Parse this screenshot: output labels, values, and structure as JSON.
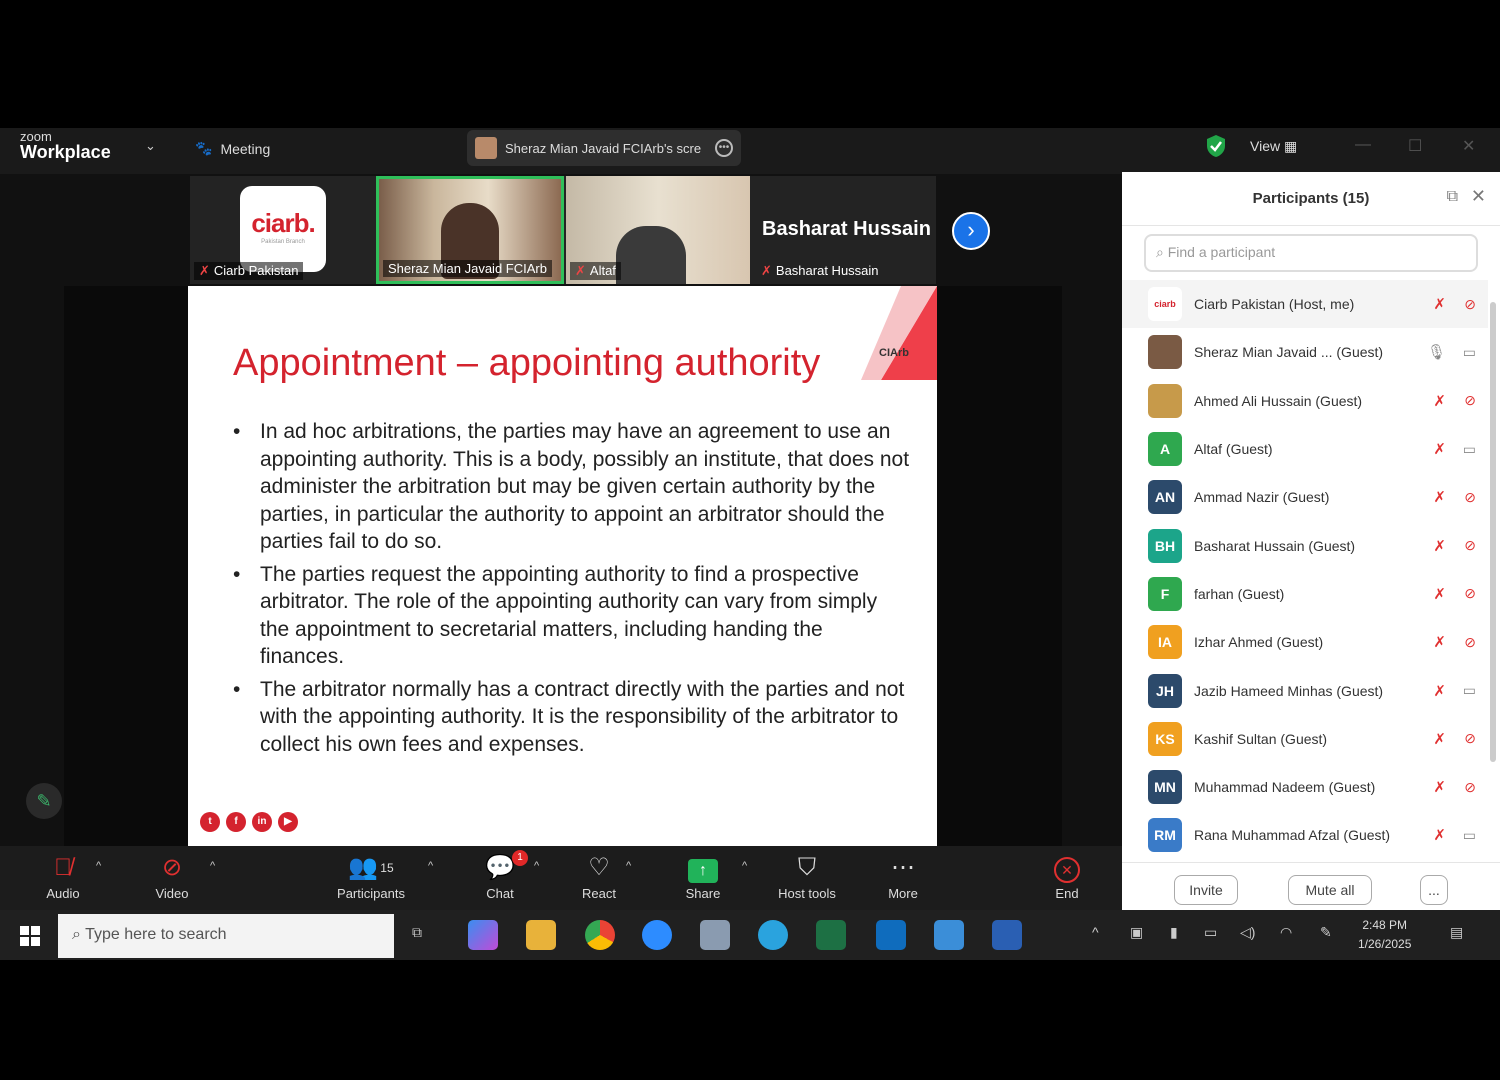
{
  "window": {
    "logo_top": "zoom",
    "logo_bottom": "Workplace",
    "meeting_label": "Meeting",
    "share_label": "Sheraz Mian Javaid FCIArb's scre",
    "view_label": "View"
  },
  "gallery": {
    "tiles": [
      {
        "name": "Ciarb Pakistan",
        "logo_text": "ciarb.",
        "logo_sub": "Pakistan Branch"
      },
      {
        "name": "Sheraz Mian Javaid FCIArb"
      },
      {
        "name": "Altaf"
      },
      {
        "name": "Basharat Hussain",
        "big_name": "Basharat Hussain"
      }
    ]
  },
  "slide": {
    "title": "Appointment – appointing authority",
    "logo_text": "CIArb",
    "bullets": [
      "In ad hoc arbitrations, the parties may have an agreement to use an appointing authority. This is a body, possibly an institute, that does not administer the arbitration but may be given certain authority by the parties, in particular the authority to appoint an arbitrator should the parties fail to do so.",
      "The parties request the appointing authority to find a prospective arbitrator. The role of the appointing authority can vary from simply the appointment to secretarial matters, including handing the finances.",
      "The arbitrator normally has a contract directly with the parties and not with the appointing authority. It is the responsibility of the arbitrator to collect his own fees and expenses."
    ]
  },
  "toolbar": {
    "audio": "Audio",
    "video": "Video",
    "participants": "Participants",
    "participants_count": "15",
    "chat": "Chat",
    "chat_badge": "1",
    "react": "React",
    "share": "Share",
    "host_tools": "Host tools",
    "more": "More",
    "end": "End"
  },
  "panel": {
    "title": "Participants (15)",
    "search_placeholder": "Find a participant",
    "participants": [
      {
        "name": "Ciarb Pakistan (Host, me)",
        "initials": "",
        "color": "#ffffff",
        "mic": "muted",
        "cam": "off"
      },
      {
        "name": "Sheraz Mian Javaid ... (Guest)",
        "initials": "",
        "color": "#7a5a44",
        "mic": "on",
        "cam": "on"
      },
      {
        "name": "Ahmed Ali Hussain (Guest)",
        "initials": "",
        "color": "#c79a4a",
        "mic": "muted",
        "cam": "off"
      },
      {
        "name": "Altaf (Guest)",
        "initials": "A",
        "color": "#2fa84f",
        "mic": "muted",
        "cam": "on"
      },
      {
        "name": "Ammad Nazir (Guest)",
        "initials": "AN",
        "color": "#2c4a6b",
        "mic": "muted",
        "cam": "off"
      },
      {
        "name": "Basharat Hussain (Guest)",
        "initials": "BH",
        "color": "#1ca58a",
        "mic": "muted",
        "cam": "off"
      },
      {
        "name": "farhan (Guest)",
        "initials": "F",
        "color": "#2fa84f",
        "mic": "muted",
        "cam": "off"
      },
      {
        "name": "Izhar Ahmed (Guest)",
        "initials": "IA",
        "color": "#f0a020",
        "mic": "muted",
        "cam": "off"
      },
      {
        "name": "Jazib Hameed Minhas (Guest)",
        "initials": "JH",
        "color": "#2c4a6b",
        "mic": "muted",
        "cam": "on"
      },
      {
        "name": "Kashif Sultan (Guest)",
        "initials": "KS",
        "color": "#f0a020",
        "mic": "muted",
        "cam": "off"
      },
      {
        "name": "Muhammad Nadeem (Guest)",
        "initials": "MN",
        "color": "#2c4a6b",
        "mic": "muted",
        "cam": "off"
      },
      {
        "name": "Rana Muhammad Afzal (Guest)",
        "initials": "RM",
        "color": "#3a7bc8",
        "mic": "muted",
        "cam": "on"
      }
    ],
    "invite": "Invite",
    "mute_all": "Mute all",
    "more": "..."
  },
  "taskbar": {
    "search_placeholder": "Type here to search",
    "time": "2:48 PM",
    "date": "1/26/2025"
  },
  "colors": {
    "accent_red": "#d4232e",
    "active_green": "#3bb36a",
    "link_blue": "#1a73e8"
  }
}
